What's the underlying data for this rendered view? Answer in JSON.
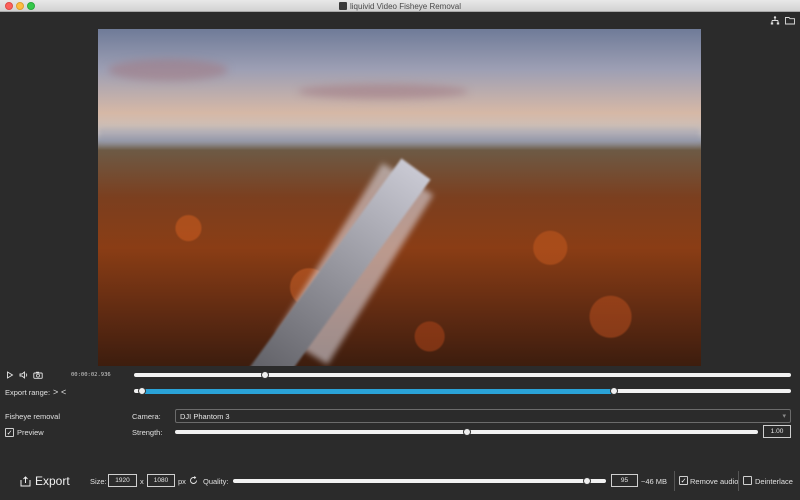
{
  "window": {
    "title": "liquivid Video Fisheye Removal"
  },
  "icons": {
    "top_left_icon": "hierarchy-icon",
    "top_right_icon": "folder-icon",
    "play": "play-icon",
    "volume": "volume-icon",
    "snapshot": "camera-icon",
    "export": "export-icon",
    "reset": "reset-icon"
  },
  "playback": {
    "time": "00:00:02.936",
    "position": 0.2
  },
  "export_range": {
    "label": "Export range:",
    "in_marker": ">",
    "out_marker": "<",
    "start": 0.012,
    "end": 0.73
  },
  "fisheye": {
    "section_label": "Fisheye removal",
    "preview_label": "Preview",
    "preview_checked": true,
    "camera_label": "Camera:",
    "camera_value": "DJI Phantom 3",
    "strength_label": "Strength:",
    "strength_value": "1.00",
    "strength_position": 0.5
  },
  "export": {
    "button_label": "Export",
    "size_label": "Size:",
    "width": "1920",
    "x_label": "x",
    "height": "1080",
    "px_label": "px",
    "quality_label": "Quality:",
    "quality_value": "95",
    "quality_position": 0.95,
    "size_estimate": "~46 MB",
    "remove_audio_label": "Remove audio",
    "remove_audio_checked": true,
    "deinterlace_label": "Deinterlace",
    "deinterlace_checked": false
  },
  "colors": {
    "accent": "#2aa3d8",
    "background": "#2b2b2b"
  }
}
